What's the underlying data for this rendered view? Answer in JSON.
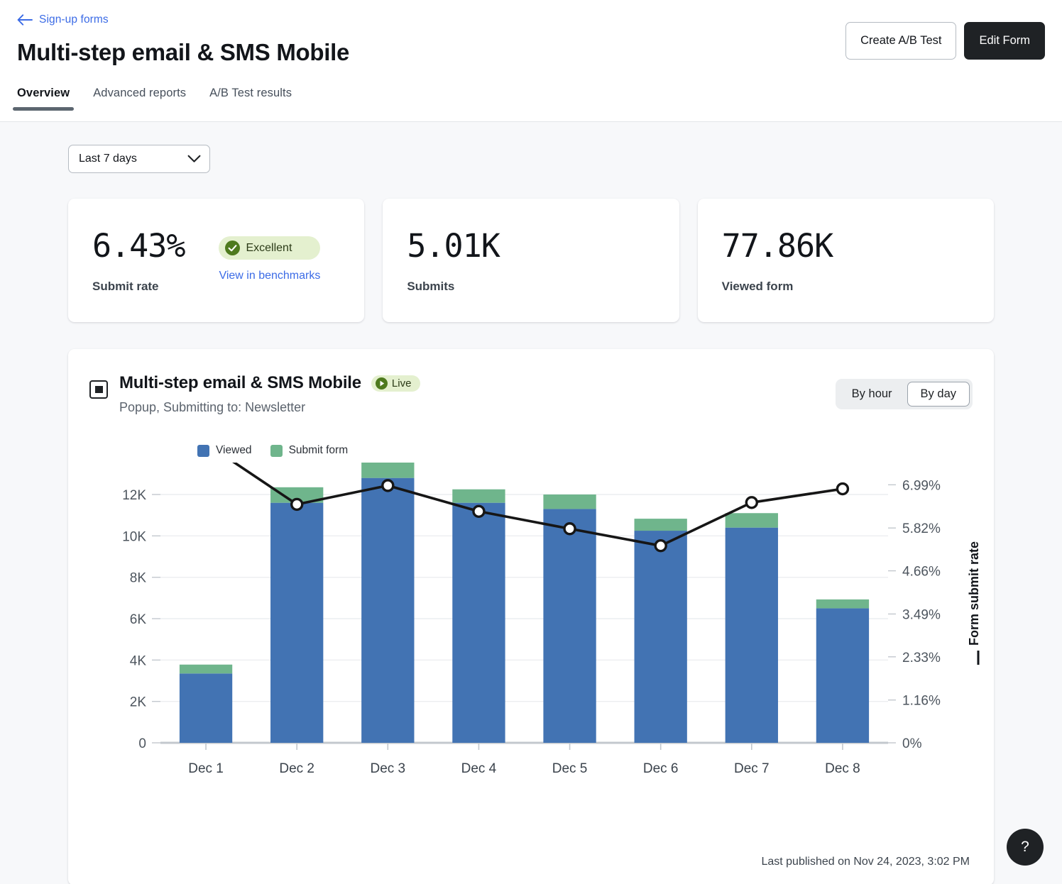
{
  "header": {
    "breadcrumb": "Sign-up forms",
    "title": "Multi-step email & SMS Mobile",
    "tabs": [
      {
        "label": "Overview",
        "active": true
      },
      {
        "label": "Advanced reports",
        "active": false
      },
      {
        "label": "A/B Test results",
        "active": false
      }
    ],
    "create_ab_test_label": "Create A/B Test",
    "edit_form_label": "Edit Form"
  },
  "filters": {
    "date_range_value": "Last 7 days"
  },
  "cards": [
    {
      "value": "6.43%",
      "label": "Submit rate",
      "badge": "Excellent",
      "link": "View in benchmarks"
    },
    {
      "value": "5.01K",
      "label": "Submits"
    },
    {
      "value": "77.86K",
      "label": "Viewed form"
    }
  ],
  "panel": {
    "title": "Multi-step email & SMS Mobile",
    "live_badge": "Live",
    "subtitle": "Popup, Submitting to: Newsletter",
    "granularity": [
      {
        "label": "By hour",
        "selected": false
      },
      {
        "label": "By day",
        "selected": true
      }
    ],
    "last_published": "Last published on Nov 24, 2023, 3:02 PM"
  },
  "colors": {
    "viewed": "#4273b3",
    "submit_form": "#6fb58c",
    "line": "#161616",
    "link": "#3b6be6",
    "badge_bg": "#e4f0cf",
    "badge_green": "#4e7a1e",
    "dark": "#1f2225"
  },
  "help_label": "?",
  "chart_data": {
    "type": "bar",
    "title": "Multi-step email & SMS Mobile",
    "xlabel": "",
    "ylabel": "",
    "y2label": "Form submit rate",
    "grid": true,
    "legend_position": "top-left",
    "stacked": true,
    "categories": [
      "Dec 1",
      "Dec 2",
      "Dec 3",
      "Dec 4",
      "Dec 5",
      "Dec 6",
      "Dec 7",
      "Dec 8"
    ],
    "ylim": [
      0,
      13200
    ],
    "yticks": [
      0,
      2000,
      4000,
      6000,
      8000,
      10000,
      12000
    ],
    "ytick_labels": [
      "0",
      "2K",
      "4K",
      "6K",
      "8K",
      "10K",
      "12K"
    ],
    "y2lim": [
      0,
      7.4
    ],
    "y2ticks": [
      0,
      1.16,
      2.33,
      3.49,
      4.66,
      5.82,
      6.99
    ],
    "y2tick_labels": [
      "0%",
      "1.16%",
      "2.33%",
      "3.49%",
      "4.66%",
      "5.82%",
      "6.99%"
    ],
    "series": [
      {
        "name": "Viewed",
        "type": "bar",
        "color": "#4273b3",
        "values": [
          3350,
          11600,
          12800,
          11600,
          11300,
          10250,
          10400,
          6500
        ]
      },
      {
        "name": "Submit form",
        "type": "bar",
        "color": "#6fb58c",
        "values": [
          430,
          750,
          830,
          650,
          700,
          580,
          700,
          430
        ]
      },
      {
        "name": "Form submit rate",
        "type": "line",
        "color": "#161616",
        "axis": "right",
        "values": [
          8.11,
          6.46,
          6.97,
          6.27,
          5.8,
          5.34,
          6.51,
          6.88
        ]
      }
    ]
  }
}
